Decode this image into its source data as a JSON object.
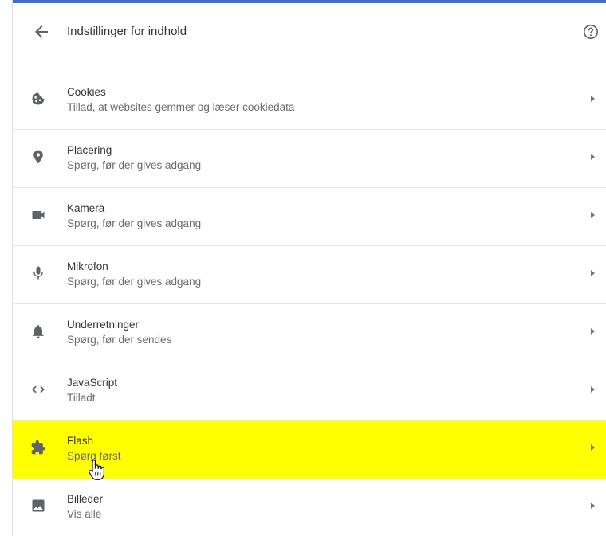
{
  "header": {
    "title": "Indstillinger for indhold",
    "back_icon": "arrow-back-icon",
    "help_icon": "help-icon"
  },
  "colors": {
    "accent": "#3b6fd0",
    "highlight": "#ffff00",
    "icon": "#5f6368"
  },
  "rows": [
    {
      "title": "Cookies",
      "subtitle": "Tillad, at websites gemmer og læser cookiedata",
      "icon": "cookie-icon"
    },
    {
      "title": "Placering",
      "subtitle": "Spørg, før der gives adgang",
      "icon": "location-pin-icon"
    },
    {
      "title": "Kamera",
      "subtitle": "Spørg, før der gives adgang",
      "icon": "camera-icon"
    },
    {
      "title": "Mikrofon",
      "subtitle": "Spørg, før der gives adgang",
      "icon": "microphone-icon"
    },
    {
      "title": "Underretninger",
      "subtitle": "Spørg, før der sendes",
      "icon": "bell-icon"
    },
    {
      "title": "JavaScript",
      "subtitle": "Tilladt",
      "icon": "code-brackets-icon"
    },
    {
      "title": "Flash",
      "subtitle": "Spørg først",
      "icon": "puzzle-piece-icon"
    },
    {
      "title": "Billeder",
      "subtitle": "Vis alle",
      "icon": "image-icon"
    }
  ]
}
